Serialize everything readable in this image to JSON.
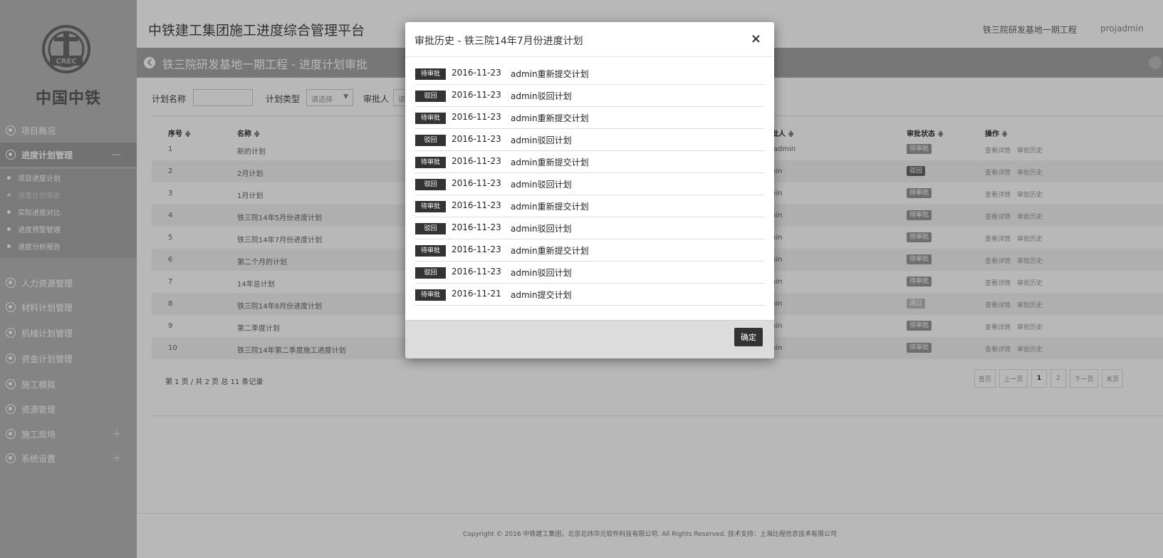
{
  "logo": {
    "name": "中国中铁",
    "mark_text": "CREC"
  },
  "header": {
    "app_title": "中铁建工集团施工进度综合管理平台",
    "project": "铁三院研发基地一期工程",
    "user": "projadmin"
  },
  "sidebar": {
    "items": [
      {
        "label": "项目概况",
        "icon": "dashboard-icon"
      },
      {
        "label": "进度计划管理",
        "icon": "clock-icon",
        "expand": "—"
      },
      {
        "label": "人力资源管理",
        "icon": "person-icon"
      },
      {
        "label": "材料计划管理",
        "icon": "material-icon"
      },
      {
        "label": "机械计划管理",
        "icon": "machine-icon"
      },
      {
        "label": "资金计划管理",
        "icon": "yen-icon"
      },
      {
        "label": "施工模拟",
        "icon": "simulation-icon"
      },
      {
        "label": "资源管理",
        "icon": "resource-icon"
      },
      {
        "label": "施工现场",
        "icon": "site-icon",
        "expand": "+"
      },
      {
        "label": "系统设置",
        "icon": "settings-icon",
        "expand": "+"
      }
    ],
    "subitems": [
      {
        "label": "项目进度计划"
      },
      {
        "label": "进度计划审批"
      },
      {
        "label": "实际进度对比"
      },
      {
        "label": "进度预警管理"
      },
      {
        "label": "进度分析报告"
      }
    ]
  },
  "page": {
    "title": "铁三院研发基地一期工程 - 进度计划审批"
  },
  "filters": {
    "name_label": "计划名称",
    "type_label": "计划类型",
    "type_placeholder": "请选择",
    "approver_label": "审批人",
    "approver_placeholder": "请"
  },
  "table": {
    "columns": [
      "序号 ≑",
      "名称 ≑",
      "批人 ≑",
      "审批状态 ≑",
      "操作 ≑"
    ],
    "rows": [
      {
        "no": "1",
        "name": "新的计划",
        "approver": "jadmin",
        "status": "待审批"
      },
      {
        "no": "2",
        "name": "2月计划",
        "approver": "nin",
        "status": "驳回"
      },
      {
        "no": "3",
        "name": "1月计划",
        "approver": "nin",
        "status": "待审批"
      },
      {
        "no": "4",
        "name": "铁三院14年5月份进度计划",
        "approver": "nin",
        "status": "待审批"
      },
      {
        "no": "5",
        "name": "铁三院14年7月份进度计划",
        "approver": "nin",
        "status": "待审批"
      },
      {
        "no": "6",
        "name": "第二个月的计划",
        "approver": "nin",
        "status": "待审批"
      },
      {
        "no": "7",
        "name": "14年总计划",
        "approver": "nin",
        "status": "待审批"
      },
      {
        "no": "8",
        "name": "铁三院14年8月份进度计划",
        "approver": "nin",
        "status": "通过"
      },
      {
        "no": "9",
        "name": "第二季度计划",
        "approver": "nin",
        "status": "待审批"
      },
      {
        "no": "10",
        "name": "铁三院14年第二季度施工进度计划",
        "approver": "nin",
        "status": "待审批"
      }
    ],
    "op_view": "查看详情",
    "op_history": "审批历史",
    "page_info": "第 1 页 / 共 2 页   总 11 条记录",
    "pager": {
      "first": "首页",
      "prev": "上一页",
      "p1": "1",
      "p2": "2",
      "next": "下一页",
      "last": "末页"
    }
  },
  "footer": {
    "copyright": "Copyright © 2016 中铁建工集团，北京北纬华元软件科技有限公司. All Rights Reserved. 技术支持：上海比程信息技术有限公司"
  },
  "modal": {
    "title": "审批历史 - 铁三院14年7月份进度计划",
    "close": "×",
    "confirm": "确定",
    "history": [
      {
        "badge": "待审批",
        "date": "2016-11-23",
        "text": "admin重新提交计划"
      },
      {
        "badge": "驳回",
        "date": "2016-11-23",
        "text": "admin驳回计划"
      },
      {
        "badge": "待审批",
        "date": "2016-11-23",
        "text": "admin重新提交计划"
      },
      {
        "badge": "驳回",
        "date": "2016-11-23",
        "text": "admin驳回计划"
      },
      {
        "badge": "待审批",
        "date": "2016-11-23",
        "text": "admin重新提交计划"
      },
      {
        "badge": "驳回",
        "date": "2016-11-23",
        "text": "admin驳回计划"
      },
      {
        "badge": "待审批",
        "date": "2016-11-23",
        "text": "admin重新提交计划"
      },
      {
        "badge": "驳回",
        "date": "2016-11-23",
        "text": "admin驳回计划"
      },
      {
        "badge": "待审批",
        "date": "2016-11-23",
        "text": "admin重新提交计划"
      },
      {
        "badge": "驳回",
        "date": "2016-11-23",
        "text": "admin驳回计划"
      },
      {
        "badge": "待审批",
        "date": "2016-11-21",
        "text": "admin提交计划"
      }
    ]
  }
}
